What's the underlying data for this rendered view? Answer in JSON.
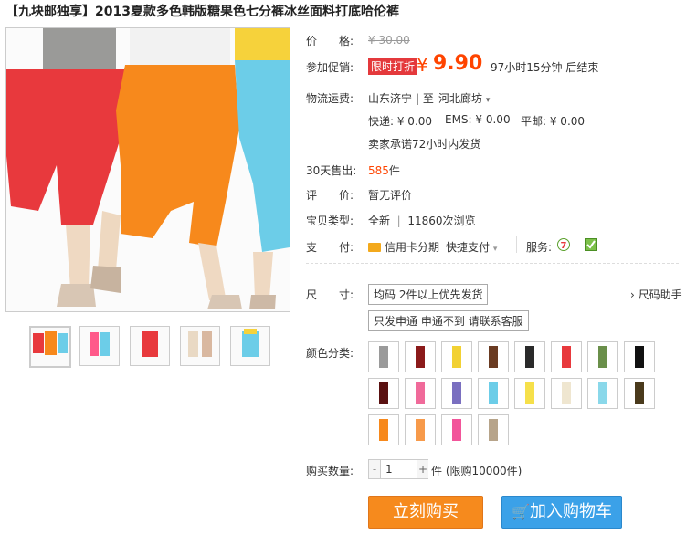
{
  "title": "【九块邮独享】2013夏款多色韩版糖果色七分裤冰丝面料打底哈伦裤",
  "colors": {
    "accent": "#ff4400",
    "buy_button": "#f68a1d",
    "cart_button": "#3ba1e8",
    "pants": [
      "#e83a3a",
      "#f78a1e",
      "#6ccde8",
      "#e9d9c4"
    ]
  },
  "price": {
    "label": "价　　格:",
    "original": "¥ 30.00"
  },
  "promo": {
    "label": "参加促销:",
    "tag": "限时打折",
    "currency": "¥",
    "price": "9.90",
    "countdown": "97小时15分钟 后结束"
  },
  "shipping": {
    "label": "物流运费:",
    "from": "山东济宁",
    "to_sep": "| 至",
    "to": "河北廊坊",
    "express": "快递: ¥ 0.00",
    "ems": "EMS: ¥ 0.00",
    "post": "平邮: ¥ 0.00",
    "promise": "卖家承诺72小时内发货"
  },
  "sold": {
    "label": "30天售出:",
    "count": "585",
    "unit": "件"
  },
  "review": {
    "label": "评　　价:",
    "value": "暂无评价"
  },
  "type": {
    "label": "宝贝类型:",
    "value": "全新",
    "sep": "|",
    "views": "11860次浏览"
  },
  "payment": {
    "label": "支　　付:",
    "card": "信用卡分期",
    "quick": "快捷支付",
    "service_label": "服务:",
    "card_icon": "credit-card-icon",
    "quick_icon": "dropdown-icon"
  },
  "size": {
    "label": "尺　　寸:",
    "option1": "均码 2件以上优先发货",
    "option2": "只发申通 申通不到 请联系客服",
    "helper": "尺码助手"
  },
  "color_label": "颜色分类:",
  "quantity": {
    "label": "购买数量:",
    "minus": "-",
    "value": "1",
    "plus": "+",
    "unit": "件 (限购10000件)"
  },
  "buttons": {
    "buy": "立刻购买",
    "cart": "加入购物车",
    "cart_icon": "cart-icon"
  }
}
